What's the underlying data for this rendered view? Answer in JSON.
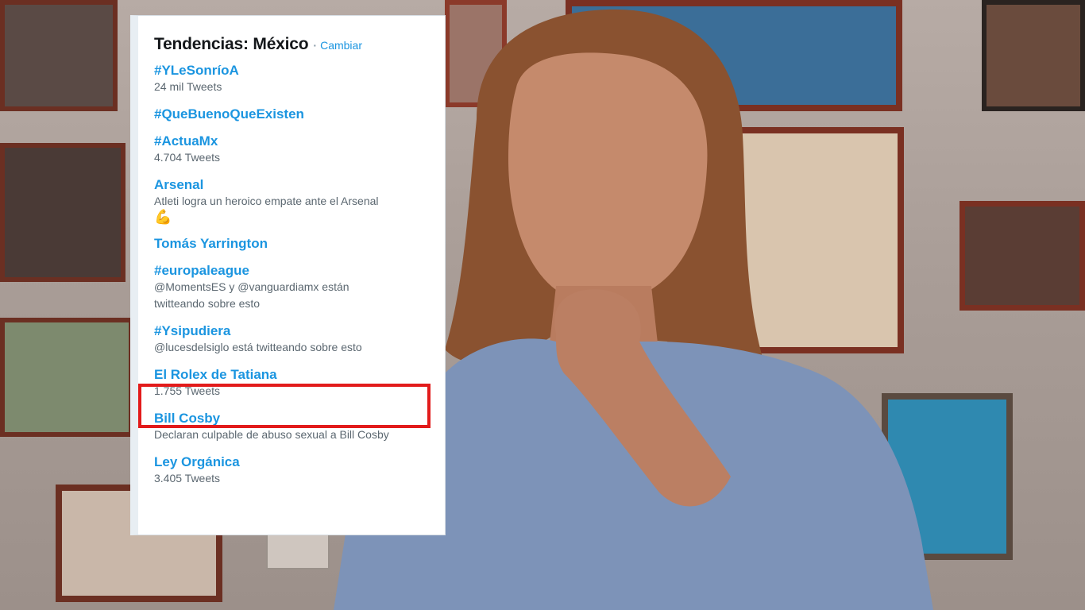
{
  "trends_panel": {
    "title": "Tendencias: México",
    "separator": "·",
    "change_link": "Cambiar",
    "trends": [
      {
        "name": "#YLeSonríoA",
        "meta": "24 mil Tweets"
      },
      {
        "name": "#QueBuenoQueExisten",
        "meta": ""
      },
      {
        "name": "#ActuaMx",
        "meta": "4.704 Tweets"
      },
      {
        "name": "Arsenal",
        "meta": "Atleti logra un heroico empate ante el Arsenal",
        "emoji": "💪"
      },
      {
        "name": "Tomás Yarrington",
        "meta": ""
      },
      {
        "name": "#europaleague",
        "meta": "@MomentsES y @vanguardiamx están twitteando sobre esto"
      },
      {
        "name": "#Ysipudiera",
        "meta": "@lucesdelsiglo está twitteando sobre esto"
      },
      {
        "name": "El Rolex de Tatiana",
        "meta": "1.755 Tweets",
        "highlighted": true
      },
      {
        "name": "Bill Cosby",
        "meta": "Declaran culpable de abuso sexual a Bill Cosby"
      },
      {
        "name": "Ley Orgánica",
        "meta": "3.405 Tweets"
      }
    ]
  },
  "colors": {
    "link_blue": "#1b95e0",
    "highlight_red": "#e21b1b",
    "meta_gray": "#5b6770"
  }
}
